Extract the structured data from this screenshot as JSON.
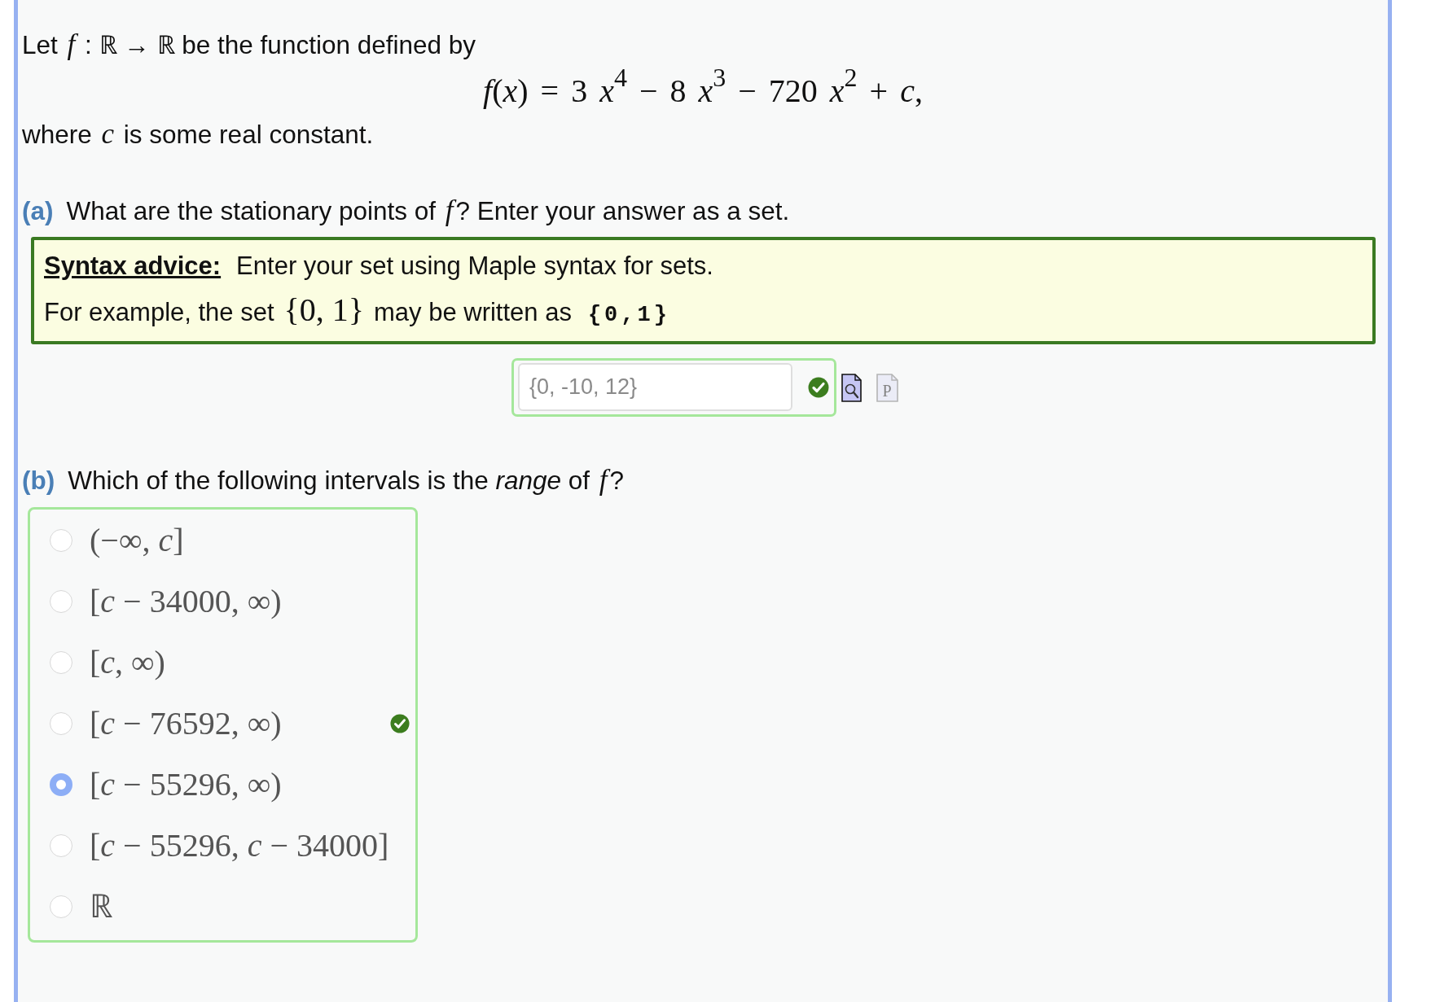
{
  "intro": {
    "statement": "Let *f* : ℝ → ℝ be the function defined by",
    "formula": "*f*(*x*) = 3 *x*$^{4}$ − 8 *x*$^{3}$ − 720 *x*$^{2}$ + *c*,",
    "note": "where *c* is some real constant."
  },
  "part_a": {
    "label": "(a)",
    "question": "What are the stationary points of *f*? Enter your answer as a set.",
    "syntax_advice": {
      "title": "Syntax advice:",
      "text": "Enter your set using Maple syntax for sets.",
      "example": {
        "text_before": "For example, the set",
        "math": "{0, 1}",
        "text_after": "may be written as",
        "code": "{0,1}"
      }
    },
    "answer": {
      "value": "{0, -10, 12}",
      "disabled": true,
      "correct": true
    },
    "tools": [
      {
        "kind": "preview",
        "disabled": false
      },
      {
        "kind": "document",
        "letter": "P",
        "disabled": true
      }
    ]
  },
  "part_b": {
    "label": "(b)",
    "question": "Which of the following intervals is the *range* of *f*?",
    "correct": true,
    "options": [
      {
        "text": "(−∞, *c*]",
        "selected": false
      },
      {
        "text": "[*c* − 34000, ∞)",
        "selected": false
      },
      {
        "text": "[*c*, ∞)",
        "selected": false
      },
      {
        "text": "[*c* − 76592, ∞)",
        "selected": false
      },
      {
        "text": "[*c* − 55296, ∞)",
        "selected": true
      },
      {
        "text": "[*c* − 55296, *c* − 34000]",
        "selected": false
      },
      {
        "text": "ℝ",
        "selected": false
      }
    ]
  }
}
